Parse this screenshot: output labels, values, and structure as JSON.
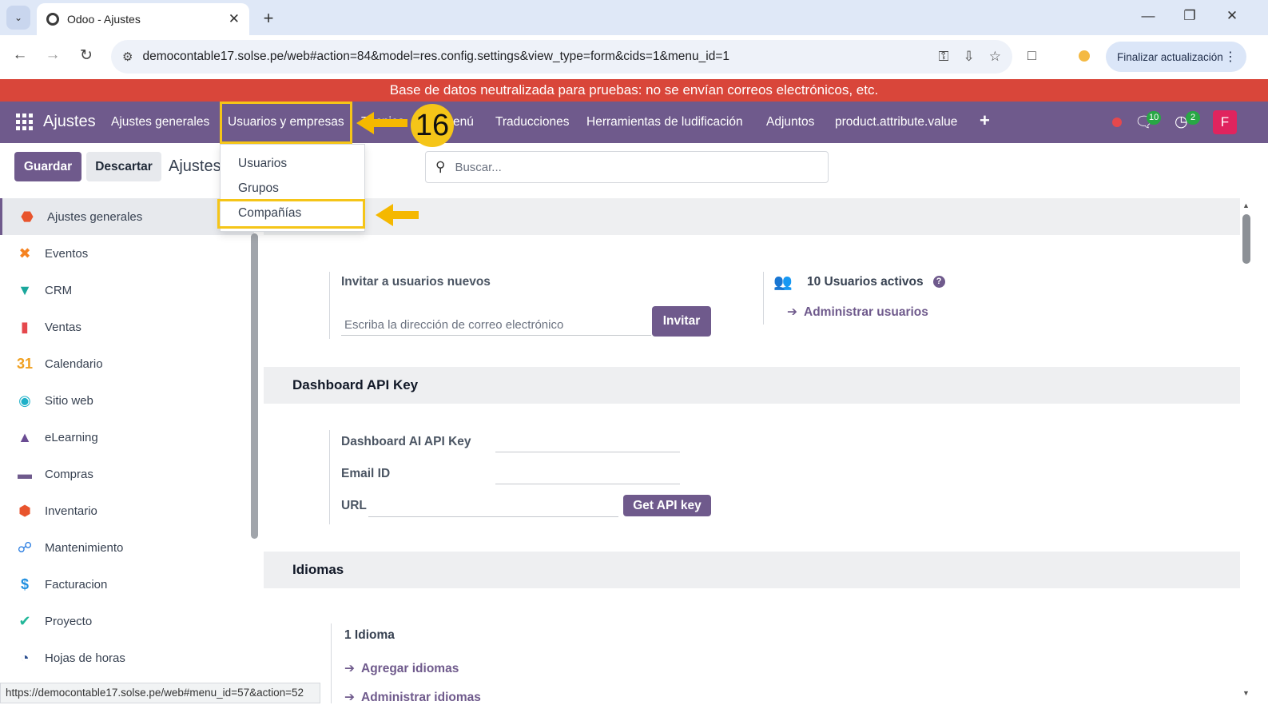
{
  "browser": {
    "tab_title": "Odoo - Ajustes",
    "url": "democontable17.solse.pe/web#action=84&model=res.config.settings&view_type=form&cids=1&menu_id=1",
    "update_label": "Finalizar actualización",
    "status_url": "https://democontable17.solse.pe/web#menu_id=57&action=52"
  },
  "banner": {
    "text": "Base de datos neutralizada para pruebas: no se envían correos electrónicos, etc."
  },
  "navbar": {
    "brand": "Ajustes",
    "items": [
      {
        "label": "Ajustes generales"
      },
      {
        "label": "Usuarios y empresas"
      },
      {
        "label": "Técnico"
      },
      {
        "label": "enú"
      },
      {
        "label": "Traducciones"
      },
      {
        "label": "Herramientas de ludificación"
      },
      {
        "label": "Adjuntos"
      },
      {
        "label": "product.attribute.value"
      }
    ],
    "chat_badge": "10",
    "activity_badge": "2",
    "avatar_letter": "F"
  },
  "annotation": {
    "step": "16",
    "accent": "#f5c518"
  },
  "control_panel": {
    "save_label": "Guardar",
    "discard_label": "Descartar",
    "title": "Ajustes",
    "search_placeholder": "Buscar..."
  },
  "dropdown": {
    "items": [
      {
        "label": "Usuarios"
      },
      {
        "label": "Grupos"
      },
      {
        "label": "Compañías"
      }
    ]
  },
  "sidebar": {
    "items": [
      {
        "label": "Ajustes generales",
        "icon": "settings-app-icon",
        "color": "#e8542d",
        "active": true
      },
      {
        "label": "Eventos",
        "icon": "events-app-icon",
        "color": "#f58220"
      },
      {
        "label": "CRM",
        "icon": "crm-app-icon",
        "color": "#1aa79c"
      },
      {
        "label": "Ventas",
        "icon": "sales-app-icon",
        "color": "#e5484d"
      },
      {
        "label": "Calendario",
        "icon": "calendar-app-icon",
        "color": "#f0a020"
      },
      {
        "label": "Sitio web",
        "icon": "website-app-icon",
        "color": "#1eb0c8"
      },
      {
        "label": "eLearning",
        "icon": "elearning-app-icon",
        "color": "#6a4c93"
      },
      {
        "label": "Compras",
        "icon": "purchase-app-icon",
        "color": "#6f5a8c"
      },
      {
        "label": "Inventario",
        "icon": "inventory-app-icon",
        "color": "#e8542d"
      },
      {
        "label": "Mantenimiento",
        "icon": "maintenance-app-icon",
        "color": "#2a7de1"
      },
      {
        "label": "Facturacion",
        "icon": "invoicing-app-icon",
        "color": "#1f8fe0"
      },
      {
        "label": "Proyecto",
        "icon": "project-app-icon",
        "color": "#21b799"
      },
      {
        "label": "Hojas de horas",
        "icon": "timesheets-app-icon",
        "color": "#2a4d8f"
      }
    ]
  },
  "users_section": {
    "invite_title": "Invitar a usuarios nuevos",
    "invite_placeholder": "Escriba la dirección de correo electrónico",
    "invite_button": "Invitar",
    "active_users": "10 Usuarios activos",
    "manage_users": "Administrar usuarios"
  },
  "dashboard_section": {
    "title": "Dashboard API Key",
    "api_key_label": "Dashboard AI API Key",
    "email_label": "Email ID",
    "url_label": "URL",
    "get_key_button": "Get API key"
  },
  "languages_section": {
    "title": "Idiomas",
    "count": "1 Idioma",
    "add_link": "Agregar idiomas",
    "manage_link": "Administrar idiomas"
  }
}
